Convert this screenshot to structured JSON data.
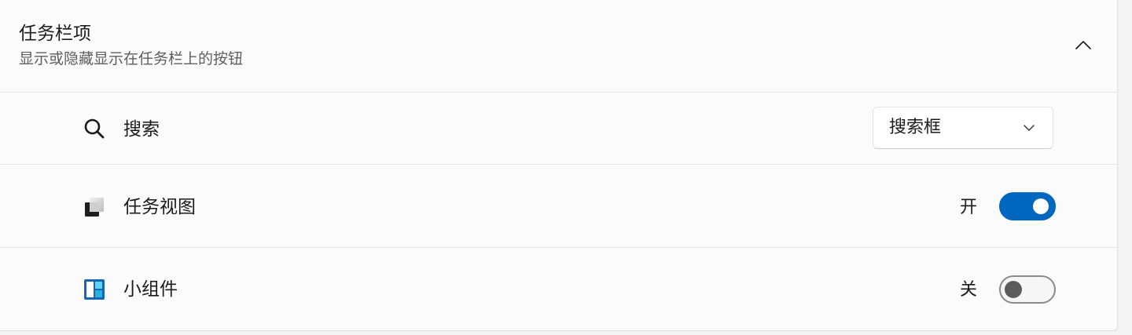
{
  "section": {
    "title": "任务栏项",
    "subtitle": "显示或隐藏显示在任务栏上的按钮",
    "collapse_icon": "chevron-up-icon"
  },
  "items": {
    "search": {
      "label": "搜索",
      "icon": "search-icon",
      "dropdown_value": "搜索框"
    },
    "task_view": {
      "label": "任务视图",
      "icon": "task-view-icon",
      "state_text": "开",
      "on": true
    },
    "widgets": {
      "label": "小组件",
      "icon": "widgets-icon",
      "state_text": "关",
      "on": false
    }
  },
  "colors": {
    "accent": "#0067c0",
    "panel_background": "#fbfbfb",
    "page_background": "#f3f3f3"
  }
}
